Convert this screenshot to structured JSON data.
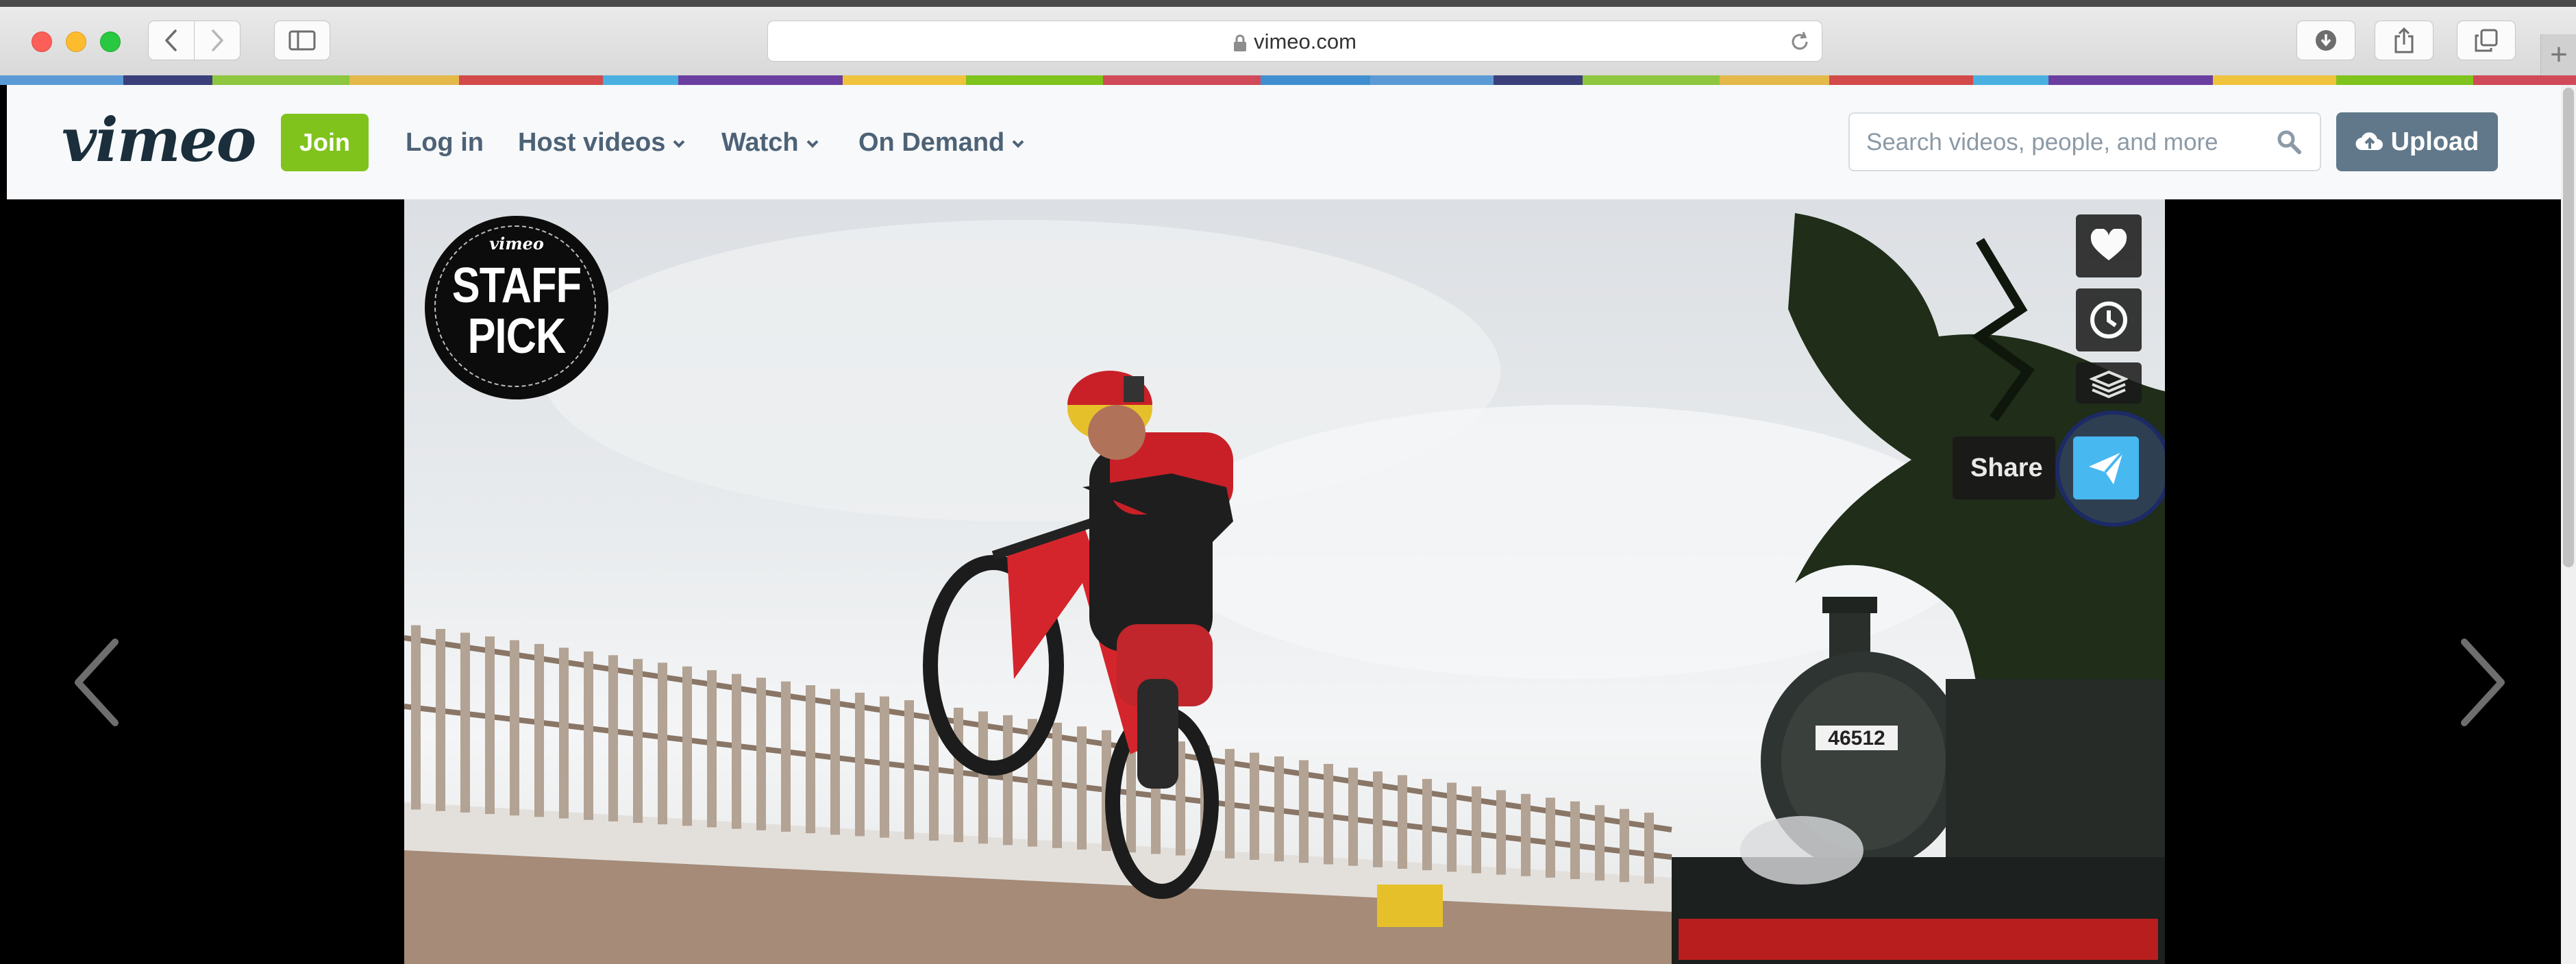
{
  "browser": {
    "url": "vimeo.com",
    "icons": [
      "back-icon",
      "forward-icon",
      "sidebar-icon",
      "lock-icon",
      "reload-icon",
      "download-icon",
      "share-icon",
      "tabs-icon",
      "plus-icon"
    ]
  },
  "stripe_colors": [
    "#5b9bd5",
    "#3b3f7a",
    "#8dc63f",
    "#e4b94a",
    "#d24a4a",
    "#49b0e1",
    "#6b3fa0",
    "#f0c33c",
    "#7fc31c",
    "#d04a5a",
    "#3f8fd0"
  ],
  "header": {
    "logo_text": "vimeo",
    "join_label": "Join",
    "nav": {
      "login": "Log in",
      "host_videos": "Host videos",
      "watch": "Watch",
      "on_demand": "On Demand"
    },
    "search_placeholder": "Search videos, people, and more",
    "upload_label": "Upload",
    "colors": {
      "join": "#7fc31c",
      "upload": "#60788a",
      "nav_text": "#4d6276",
      "logo": "#1a2e3b"
    }
  },
  "video": {
    "badge_small": "vimeo",
    "badge_line1": "STAFF",
    "badge_line2": "PICK",
    "locomotive_number": "46512",
    "actions": {
      "like_icon": "heart-icon",
      "later_icon": "clock-icon",
      "collections_icon": "layers-icon",
      "share_icon": "paper-plane-icon",
      "share_tooltip": "Share",
      "share_color": "#47b8f0"
    }
  }
}
